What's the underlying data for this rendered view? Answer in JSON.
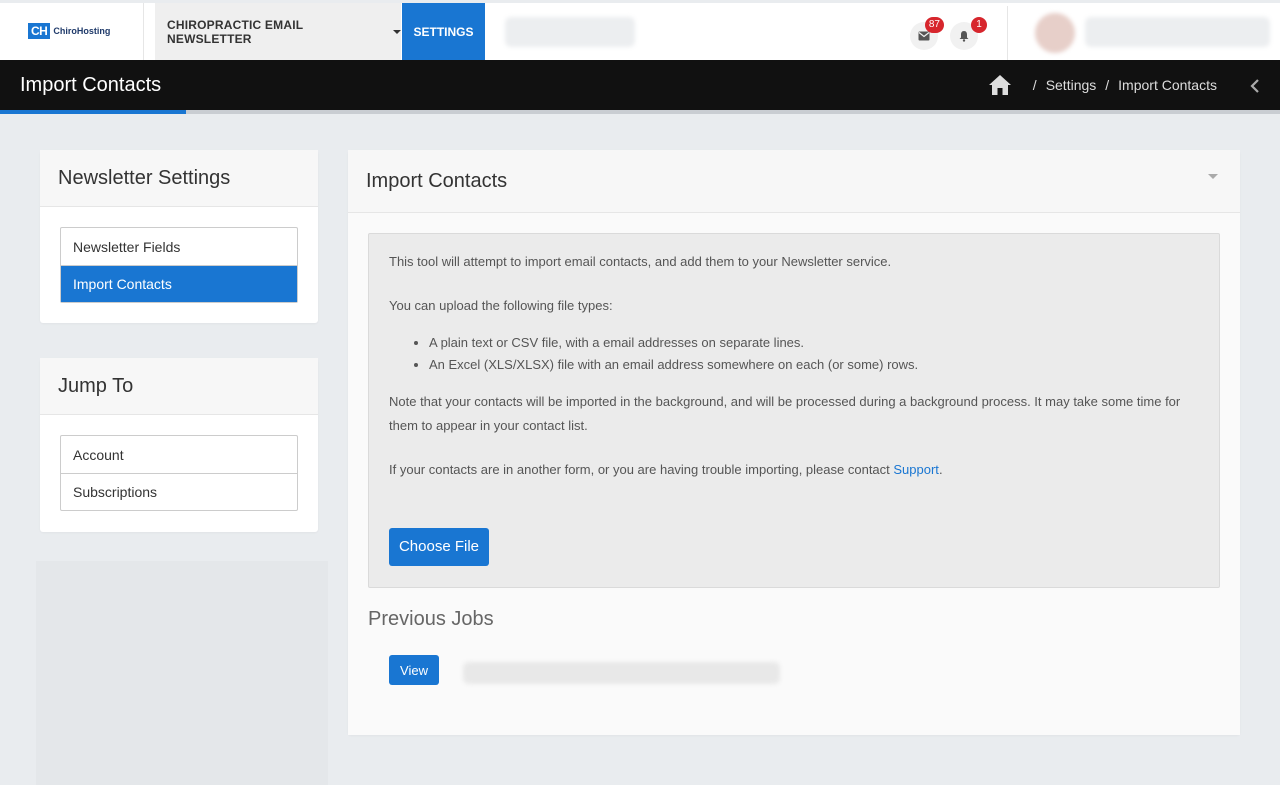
{
  "topbar": {
    "logo_mark": "CH",
    "logo_text": "ChiroHosting",
    "app_menu_label": "CHIROPRACTIC EMAIL NEWSLETTER",
    "settings_tab_label": "SETTINGS",
    "mail_badge": "87",
    "notification_badge": "1"
  },
  "header": {
    "title": "Import Contacts",
    "breadcrumbs": [
      "Settings",
      "Import Contacts"
    ]
  },
  "sidebar": {
    "newsletter_settings": {
      "title": "Newsletter Settings",
      "items": [
        {
          "label": "Newsletter Fields",
          "active": false
        },
        {
          "label": "Import Contacts",
          "active": true
        }
      ]
    },
    "jump_to": {
      "title": "Jump To",
      "items": [
        {
          "label": "Account"
        },
        {
          "label": "Subscriptions"
        }
      ]
    }
  },
  "main": {
    "title": "Import Contacts",
    "intro": "This tool will attempt to import email contacts, and add them to your Newsletter service.",
    "filetypes_intro": "You can upload the following file types:",
    "filetypes": [
      "A plain text or CSV file, with a email addresses on separate lines.",
      "An Excel (XLS/XLSX) file with an email address somewhere on each (or some) rows."
    ],
    "note": "Note that your contacts will be imported in the background, and will be processed during a background process. It may take some time for them to appear in your contact list.",
    "support_prefix": "If your contacts are in another form, or you are having trouble importing, please contact ",
    "support_link": "Support",
    "support_suffix": ".",
    "choose_file_label": "Choose File",
    "previous_jobs_title": "Previous Jobs",
    "view_button_label": "View"
  },
  "colors": {
    "accent": "#1976d2",
    "header_bg": "#111111",
    "badge": "#d7262d"
  }
}
